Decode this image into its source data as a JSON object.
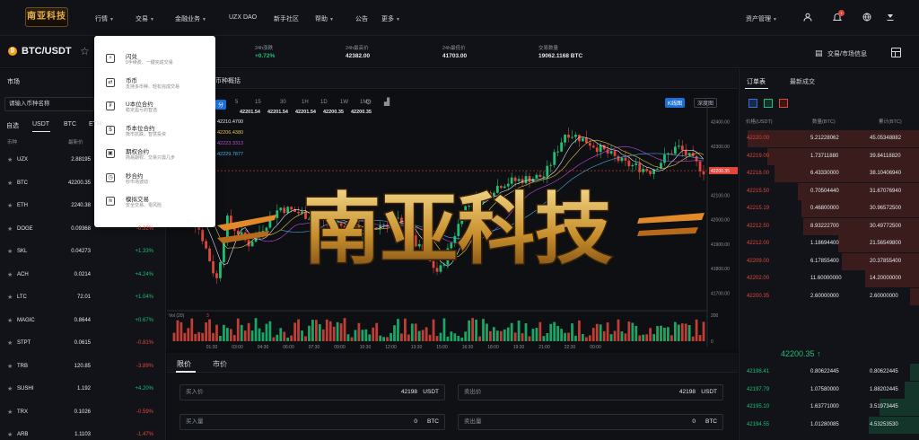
{
  "brand": {
    "logo_text": "南亚科技"
  },
  "nav": {
    "items": [
      {
        "label": "行情",
        "caret": true,
        "x": 106
      },
      {
        "label": "交易",
        "caret": true,
        "x": 151
      },
      {
        "label": "金融业务",
        "caret": true,
        "x": 195
      },
      {
        "label": "UZX DAO",
        "caret": false,
        "x": 255
      },
      {
        "label": "新手社区",
        "caret": false,
        "x": 305
      },
      {
        "label": "帮助",
        "caret": true,
        "x": 351
      },
      {
        "label": "公告",
        "caret": false,
        "x": 396
      },
      {
        "label": "更多",
        "caret": true,
        "x": 425
      }
    ],
    "asset_mgmt": "资产管理",
    "notif_count": "1"
  },
  "ticker": {
    "pair": "BTC/USDT",
    "stats": [
      {
        "label": "24h涨跌",
        "value": "+0.72%",
        "color": "#1fbf75",
        "x": 284
      },
      {
        "label": "24h最高价",
        "value": "42382.00",
        "color": "#e6e8ec",
        "x": 385
      },
      {
        "label": "24h最低价",
        "value": "41703.00",
        "color": "#e6e8ec",
        "x": 493
      },
      {
        "label": "交易数量",
        "value": "19062.1168 BTC",
        "color": "#e6e8ec",
        "x": 600
      }
    ],
    "trade_info": "交易/市场信息"
  },
  "market": {
    "title": "市场",
    "search_placeholder": "请输入币种名称",
    "tabs": [
      "自选",
      "USDT",
      "BTC",
      "ETH"
    ],
    "col_coin": "币种",
    "col_price": "最新价",
    "rows": [
      {
        "coin": "UZX",
        "price": "2.88195",
        "chg": ""
      },
      {
        "coin": "BTC",
        "price": "42200.35",
        "chg": ""
      },
      {
        "coin": "ETH",
        "price": "2240.38",
        "chg": ""
      },
      {
        "coin": "DOGE",
        "price": "0.09368",
        "chg": "-0.32%"
      },
      {
        "coin": "SKL",
        "price": "0.04273",
        "chg": "+1.33%"
      },
      {
        "coin": "ACH",
        "price": "0.0214",
        "chg": "+4.24%"
      },
      {
        "coin": "LTC",
        "price": "72.01",
        "chg": "+1.04%"
      },
      {
        "coin": "MAGIC",
        "price": "0.8644",
        "chg": "+0.67%"
      },
      {
        "coin": "STPT",
        "price": "0.0615",
        "chg": "-0.81%"
      },
      {
        "coin": "TRB",
        "price": "120.85",
        "chg": "-3.89%"
      },
      {
        "coin": "SUSHI",
        "price": "1.192",
        "chg": "+4.20%"
      },
      {
        "coin": "TRX",
        "price": "0.1026",
        "chg": "-0.59%"
      },
      {
        "coin": "ARB",
        "price": "1.1103",
        "chg": "-1.47%"
      }
    ]
  },
  "dropdown": {
    "items": [
      {
        "icon": "⚡",
        "title": "闪兑",
        "sub": "0手续费、一键完成交易"
      },
      {
        "icon": "⇄",
        "title": "币币",
        "sub": "支持多币种、轻松完成交易"
      },
      {
        "icon": "₮",
        "title": "U本位合约",
        "sub": "稳定盈亏的智选"
      },
      {
        "icon": "$",
        "title": "币本位合约",
        "sub": "熊市抗跌、智慧投资"
      },
      {
        "icon": "▣",
        "title": "期权合约",
        "sub": "简易期权、交易只需几步"
      },
      {
        "icon": "◷",
        "title": "秒合约",
        "sub": "秒市场波动"
      },
      {
        "icon": "≋",
        "title": "模拟交易",
        "sub": "安全交易、零风险"
      }
    ]
  },
  "chart": {
    "tab_label": "币种概括",
    "timeframes": [
      "分",
      "5",
      "15",
      "30",
      "1H",
      "1D",
      "1W",
      "1M"
    ],
    "active_tf": "分",
    "kline_btn": "K线图",
    "depth_btn": "深度图",
    "ohlc": [
      "42201.54",
      "42201.54",
      "42201.54",
      "42200.35",
      "42200.35"
    ],
    "ma": [
      {
        "label": "42210.4700",
        "color": "#e6e8ec"
      },
      {
        "label": "42206.4380",
        "color": "#e8c34a"
      },
      {
        "label": "42223.3313",
        "color": "#c04adf"
      },
      {
        "label": "42229.7877",
        "color": "#4ab0e8"
      }
    ],
    "price_ticks": [
      "42400.00",
      "42300.00",
      "42200.00",
      "42100.00",
      "42000.00",
      "41900.00",
      "41800.00",
      "41700.00"
    ],
    "current_price": "42200.35",
    "vol_ticks": [
      "200",
      "0"
    ],
    "vol_label": "Vol (20)",
    "vol_value": "3",
    "time_ticks": [
      "01:30",
      "03:00",
      "04:30",
      "06:00",
      "07:30",
      "09:00",
      "10:30",
      "12:00",
      "13:30",
      "15:00",
      "16:30",
      "18:00",
      "19:30",
      "21:00",
      "22:30",
      "00:00"
    ],
    "ylim": [
      41650,
      42450
    ]
  },
  "order": {
    "tabs": [
      "限价",
      "市价"
    ],
    "buy_price_label": "买入价",
    "buy_price": "42198",
    "buy_price_unit": "USDT",
    "sell_price_label": "卖出价",
    "sell_price": "42198",
    "sell_price_unit": "USDT",
    "buy_qty_label": "买入量",
    "buy_qty": "0",
    "buy_qty_unit": "BTC",
    "sell_qty_label": "卖出量",
    "sell_qty": "0",
    "sell_qty_unit": "BTC"
  },
  "orderbook": {
    "tabs": [
      "订单表",
      "最新成交"
    ],
    "cols": [
      "价格(USDT)",
      "数量(BTC)",
      "累计(BTC)"
    ],
    "asks": [
      {
        "price": "42220.00",
        "qty": "5.21228062",
        "total": "45.05348882",
        "depth": 0.95
      },
      {
        "price": "42219.00",
        "qty": "1.73711880",
        "total": "39.84118820",
        "depth": 0.84
      },
      {
        "price": "42216.00",
        "qty": "6.43330000",
        "total": "38.10406940",
        "depth": 0.8
      },
      {
        "price": "42215.50",
        "qty": "0.70504440",
        "total": "31.67076940",
        "depth": 0.67
      },
      {
        "price": "42215.19",
        "qty": "0.46800000",
        "total": "30.96572500",
        "depth": 0.65
      },
      {
        "price": "42212.50",
        "qty": "8.93222700",
        "total": "30.49772500",
        "depth": 0.64
      },
      {
        "price": "42212.00",
        "qty": "1.18694400",
        "total": "21.56549800",
        "depth": 0.45
      },
      {
        "price": "42209.00",
        "qty": "6.17855400",
        "total": "20.37855400",
        "depth": 0.43
      },
      {
        "price": "42202.00",
        "qty": "11.60000000",
        "total": "14.20000000",
        "depth": 0.3
      },
      {
        "price": "42200.35",
        "qty": "2.60000000",
        "total": "2.60000000",
        "depth": 0.05
      }
    ],
    "mid_price": "42200.35",
    "bids": [
      {
        "price": "42198.41",
        "qty": "0.80622445",
        "total": "0.80622445",
        "depth": 0.05
      },
      {
        "price": "42197.79",
        "qty": "1.07580000",
        "total": "1.88202445",
        "depth": 0.08
      },
      {
        "price": "42195.10",
        "qty": "1.63771000",
        "total": "3.51973445",
        "depth": 0.22
      },
      {
        "price": "42194.55",
        "qty": "1.01280085",
        "total": "4.53253530",
        "depth": 0.28
      }
    ]
  },
  "watermark": {
    "text": "南亚科技"
  }
}
